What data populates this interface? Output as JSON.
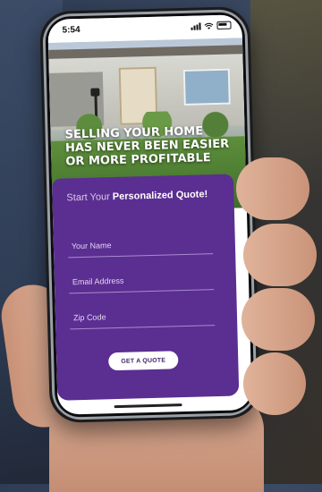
{
  "status_bar": {
    "time": "5:54"
  },
  "hero": {
    "title_lines": [
      "SELLING YOUR HOME",
      "HAS NEVER BEEN EASIER",
      "OR MORE PROFITABLE"
    ]
  },
  "quote_form": {
    "heading_light": "Start Your",
    "heading_bold": "Personalized Quote!",
    "fields": [
      {
        "placeholder": "Your Name",
        "value": ""
      },
      {
        "placeholder": "Email Address",
        "value": ""
      },
      {
        "placeholder": "Zip Code",
        "value": ""
      }
    ],
    "submit_label": "GET A QUOTE"
  },
  "colors": {
    "brand_purple": "#5b2e91",
    "button_bg": "#ffffff",
    "button_text": "#3d1f6a"
  },
  "icons": [
    "signal-icon",
    "wifi-icon",
    "battery-icon"
  ]
}
